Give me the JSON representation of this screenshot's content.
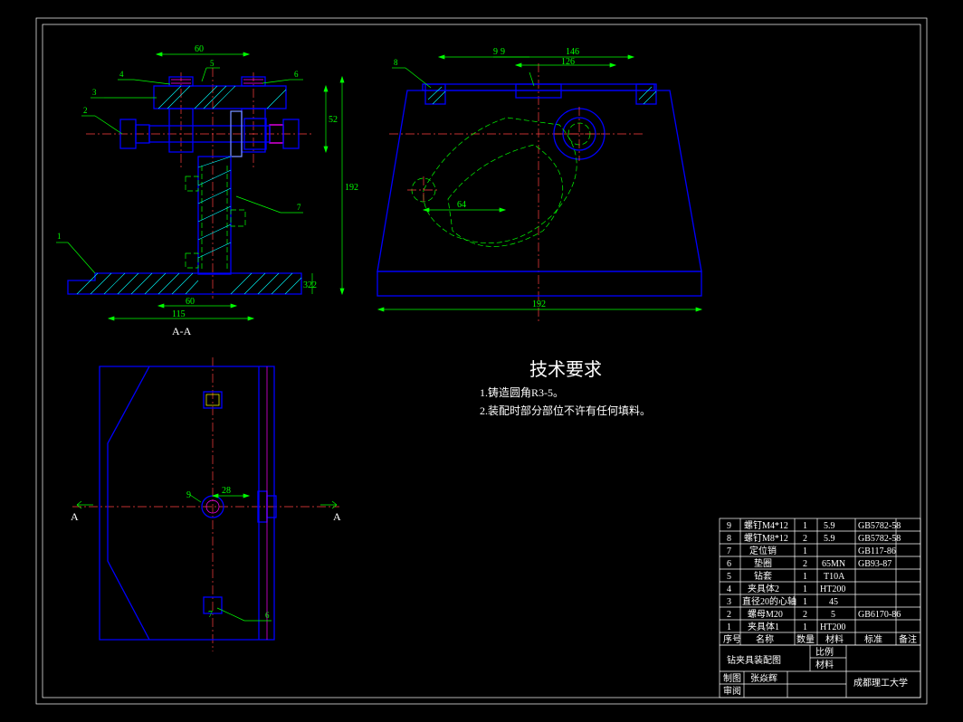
{
  "colors": {
    "bg": "#000000",
    "blue": "#0000ff",
    "cyan": "#00ffff",
    "green": "#00ff00",
    "magenta": "#ff00ff",
    "red": "#ff4040",
    "yellow": "#ffff00",
    "white": "#ffffff"
  },
  "border": {
    "outer": [
      40,
      20,
      1024,
      778
    ],
    "inner": [
      47,
      27,
      1017,
      771
    ]
  },
  "requirements": {
    "title": "技术要求",
    "lines": [
      "1.铸造圆角R3-5。",
      "2.装配时部分部位不许有任何填料。"
    ]
  },
  "title_block": {
    "drawing_title": "钻夹具装配图",
    "label_scale": "比例",
    "label_material": "材料",
    "label_drawn": "制图",
    "drawn_by": "张焱辉",
    "label_checked": "审阅",
    "label_school": "成都理工大学"
  },
  "bom_headers": {
    "no": "序号",
    "name": "名称",
    "qty": "数量",
    "material": "材料",
    "standard": "标准",
    "remark": "备注"
  },
  "bom": [
    {
      "no": "9",
      "name": "螺钉M4*12",
      "qty": "1",
      "material": "5.9",
      "standard": "GB5782-58",
      "remark": ""
    },
    {
      "no": "8",
      "name": "螺钉M8*12",
      "qty": "2",
      "material": "5.9",
      "standard": "GB5782-58",
      "remark": ""
    },
    {
      "no": "7",
      "name": "定位销",
      "qty": "1",
      "material": "",
      "standard": "GB117-86",
      "remark": ""
    },
    {
      "no": "6",
      "name": "垫圈",
      "qty": "2",
      "material": "65MN",
      "standard": "GB93-87",
      "remark": ""
    },
    {
      "no": "5",
      "name": "钻套",
      "qty": "1",
      "material": "T10A",
      "standard": "",
      "remark": ""
    },
    {
      "no": "4",
      "name": "夹具体2",
      "qty": "1",
      "material": "HT200",
      "standard": "",
      "remark": ""
    },
    {
      "no": "3",
      "name": "直径20的心轴",
      "qty": "1",
      "material": "45",
      "standard": "",
      "remark": ""
    },
    {
      "no": "2",
      "name": "螺母M20",
      "qty": "2",
      "material": "5",
      "standard": "GB6170-86",
      "remark": ""
    },
    {
      "no": "1",
      "name": "夹具体1",
      "qty": "1",
      "material": "HT200",
      "standard": "",
      "remark": ""
    }
  ],
  "balloons_left": {
    "1": "1",
    "2": "2",
    "3": "3",
    "4": "4",
    "5": "5",
    "6": "6",
    "7": "7"
  },
  "balloons_right": {
    "8": "8",
    "9": "9"
  },
  "balloons_bottom": {
    "6": "6"
  },
  "dimensions": {
    "left_view": {
      "d60_top": "60",
      "d52": "52",
      "d192": "192",
      "d60_bot": "60",
      "d115": "115",
      "ext_r": "322",
      "section": "A-A"
    },
    "right_view": {
      "d146": "146",
      "d126": "126",
      "d64": "64",
      "d192": "192",
      "d9": "9"
    },
    "bottom_view": {
      "d28": "28",
      "d7": "7",
      "d9": "9",
      "cutA_l": "A",
      "cutA_r": "A"
    }
  }
}
